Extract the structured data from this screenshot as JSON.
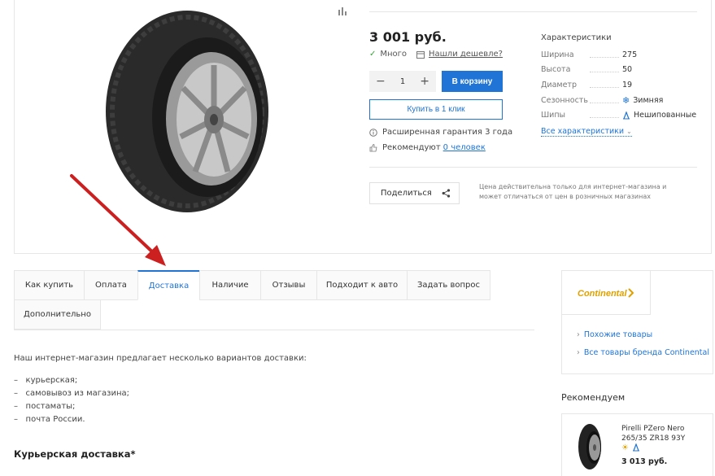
{
  "product": {
    "price": "3 001 руб.",
    "stock_label": "Много",
    "cheaper_label": "Нашли дешевле?",
    "quantity": "1",
    "cart_button": "В корзину",
    "one_click_button": "Купить в 1 клик",
    "warranty": "Расширенная гарантия 3 года",
    "recommend_prefix": "Рекомендуют",
    "recommend_link": "0 человек",
    "share_button": "Поделиться",
    "price_note": "Цена действительна только для интернет-магазина и может отличаться от цен в розничных магазинах"
  },
  "specs": {
    "title": "Характеристики",
    "rows": [
      {
        "key": "Ширина",
        "value": "275"
      },
      {
        "key": "Высота",
        "value": "50"
      },
      {
        "key": "Диаметр",
        "value": "19"
      },
      {
        "key": "Сезонность",
        "value": "Зимняя"
      },
      {
        "key": "Шипы",
        "value": "Нешипованные"
      }
    ],
    "all_link": "Все характеристики"
  },
  "tabs": [
    {
      "label": "Как купить"
    },
    {
      "label": "Оплата"
    },
    {
      "label": "Доставка"
    },
    {
      "label": "Наличие"
    },
    {
      "label": "Отзывы"
    },
    {
      "label": "Подходит к авто"
    },
    {
      "label": "Задать вопрос"
    },
    {
      "label": "Дополнительно"
    }
  ],
  "content": {
    "intro": "Наш интернет-магазин предлагает несколько вариантов доставки:",
    "bullets": [
      "курьерская;",
      "самовывоз из магазина;",
      "постаматы;",
      "почта России."
    ],
    "heading": "Курьерская доставка*"
  },
  "brand": {
    "logo_text": "Continental",
    "links": [
      "Похожие товары",
      "Все товары бренда Continental"
    ]
  },
  "recommend": {
    "title": "Рекомендуем",
    "item_name": "Pirelli PZero Nero 265/35 ZR18 93Y",
    "item_price": "3 013 руб."
  },
  "colors": {
    "accent": "#1f74d6",
    "arrow": "#cc1f1f",
    "stock": "#3aa53a"
  }
}
